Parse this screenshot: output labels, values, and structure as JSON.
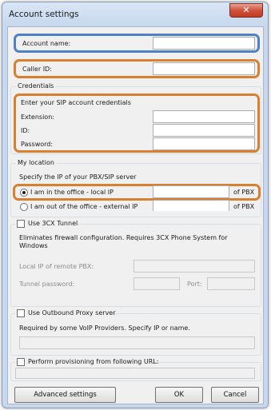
{
  "window": {
    "title": "Account settings",
    "close_glyph": "✕"
  },
  "account": {
    "name_label": "Account name:",
    "name_value": "",
    "caller_label": "Caller ID:",
    "caller_value": ""
  },
  "credentials": {
    "legend": "Credentials",
    "hint": "Enter your SIP account credentials",
    "extension_label": "Extension:",
    "id_label": "ID:",
    "password_label": "Password:"
  },
  "location": {
    "legend": "My location",
    "hint": "Specify the IP of your PBX/SIP server",
    "office_label": "I am in the office - local IP",
    "out_label": "I am out of the office - external IP",
    "pbx_suffix_1": "of PBX",
    "pbx_suffix_2": "of PBX",
    "selected": "office"
  },
  "tunnel": {
    "checkbox_label": "Use 3CX Tunnel",
    "description": "Eliminates firewall configuration. Requires 3CX Phone System for Windows",
    "local_ip_label": "Local IP of remote PBX:",
    "password_label": "Tunnel password:",
    "port_label": "Port:"
  },
  "proxy": {
    "checkbox_label": "Use Outbound Proxy server",
    "description": "Required by some VoIP Providers. Specify IP or name."
  },
  "provisioning": {
    "checkbox_label": "Perform provisioning from following URL:"
  },
  "buttons": {
    "advanced": "Advanced settings",
    "ok": "OK",
    "cancel": "Cancel"
  },
  "colors": {
    "highlight_blue": "#4f82c4",
    "highlight_orange": "#d8802f"
  }
}
